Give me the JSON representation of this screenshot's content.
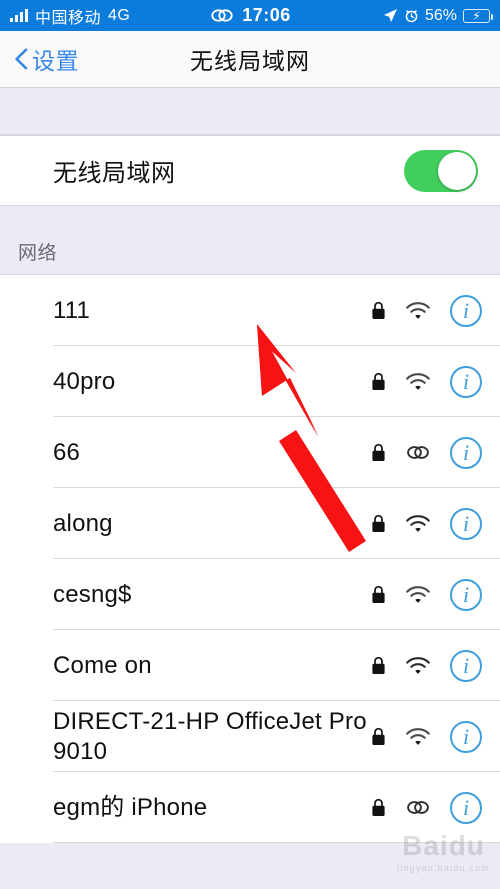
{
  "status_bar": {
    "signal_icon": "signal-bars-icon",
    "carrier": "中国移动",
    "network_type": "4G",
    "recording_icon": "personal-hotspot-icon",
    "time": "17:06",
    "location_icon": "location-arrow-icon",
    "alarm_icon": "alarm-clock-icon",
    "battery_percent": "56%",
    "battery_charging_icon": "charging-bolt-icon",
    "background_color": "#0b7bdc"
  },
  "nav_bar": {
    "back_icon": "chevron-left-icon",
    "back_label": "设置",
    "title": "无线局域网"
  },
  "wifi_toggle": {
    "label": "无线局域网",
    "state": "on",
    "on_color": "#41ce5d"
  },
  "networks_section": {
    "header": "网络",
    "rows": [
      {
        "ssid": "111",
        "lock_icon": "lock-icon",
        "signal_icon": "wifi-icon",
        "info_icon": "info-icon"
      },
      {
        "ssid": "40pro",
        "lock_icon": "lock-icon",
        "signal_icon": "wifi-icon",
        "info_icon": "info-icon"
      },
      {
        "ssid": "66",
        "lock_icon": "lock-icon",
        "signal_icon": "personal-hotspot-icon",
        "info_icon": "info-icon"
      },
      {
        "ssid": "along",
        "lock_icon": "lock-icon",
        "signal_icon": "wifi-icon",
        "info_icon": "info-icon"
      },
      {
        "ssid": "cesng$",
        "lock_icon": "lock-icon",
        "signal_icon": "wifi-icon",
        "info_icon": "info-icon"
      },
      {
        "ssid": "Come on",
        "lock_icon": "lock-icon",
        "signal_icon": "wifi-icon",
        "info_icon": "info-icon"
      },
      {
        "ssid": "DIRECT-21-HP OfficeJet Pro 9010",
        "lock_icon": "lock-icon",
        "signal_icon": "wifi-icon",
        "info_icon": "info-icon"
      },
      {
        "ssid": "egm的 iPhone",
        "lock_icon": "lock-icon",
        "signal_icon": "personal-hotspot-icon",
        "info_icon": "info-icon"
      }
    ]
  },
  "annotation": {
    "arrow_color": "#f51313",
    "arrow_from": "365,540",
    "arrow_to": "258,324"
  },
  "watermark": {
    "main": "Baidu",
    "sub": "jingyan.baidu.com"
  }
}
